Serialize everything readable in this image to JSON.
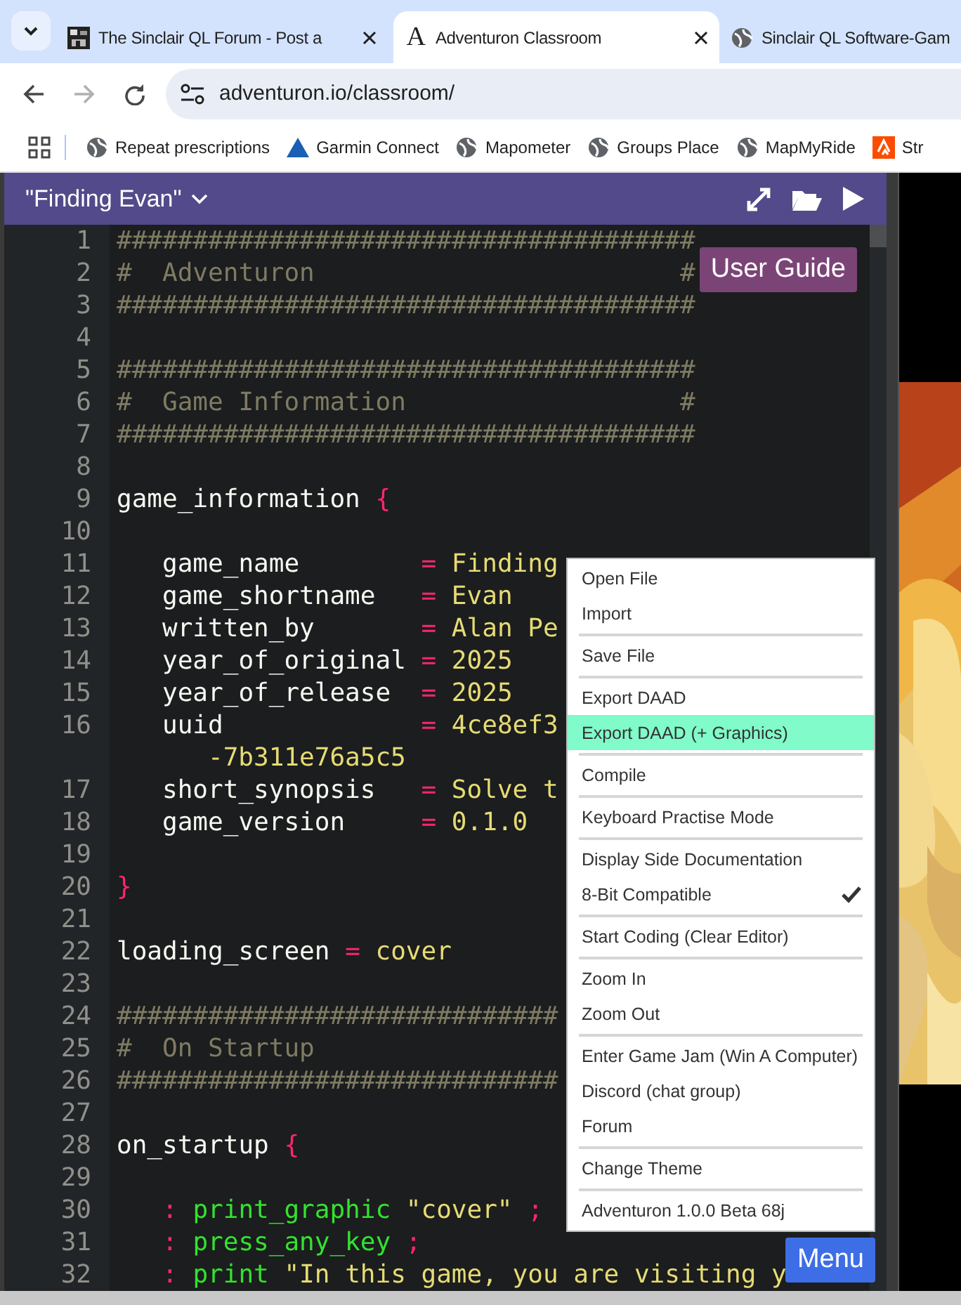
{
  "browser": {
    "tabs": [
      {
        "title": "The Sinclair QL Forum - Post a",
        "selected": false,
        "closable": true
      },
      {
        "title": "Adventuron Classroom",
        "favicon_letter": "A",
        "selected": true,
        "closable": true
      },
      {
        "title": "Sinclair QL Software-Gam",
        "selected": false,
        "closable": false
      }
    ],
    "nav_buttons": [
      {
        "kind": "back",
        "disabled": false
      },
      {
        "kind": "forward",
        "disabled": true
      },
      {
        "kind": "reload",
        "disabled": false
      }
    ],
    "address": "adventuron.io/classroom/",
    "bookmarks": [
      {
        "label": "Repeat prescriptions"
      },
      {
        "label": "Garmin Connect"
      },
      {
        "label": "Mapometer"
      },
      {
        "label": "Groups Place"
      },
      {
        "label": "MapMyRide"
      },
      {
        "label": "Str"
      }
    ]
  },
  "editor": {
    "title": "\"Finding Evan\"",
    "user_guide": "User Guide",
    "menu_button": "Menu",
    "lines": [
      {
        "number": "1",
        "segments": [
          {
            "kind": "comment",
            "text": "######################################"
          }
        ]
      },
      {
        "number": "2",
        "segments": [
          {
            "kind": "comment",
            "text": "#  Adventuron                        #"
          }
        ]
      },
      {
        "number": "3",
        "segments": [
          {
            "kind": "comment",
            "text": "######################################"
          }
        ]
      },
      {
        "number": "4"
      },
      {
        "number": "5",
        "segments": [
          {
            "kind": "comment",
            "text": "######################################"
          }
        ]
      },
      {
        "number": "6",
        "segments": [
          {
            "kind": "comment",
            "text": "#  Game Information                  #"
          }
        ]
      },
      {
        "number": "7",
        "segments": [
          {
            "kind": "comment",
            "text": "######################################"
          }
        ]
      },
      {
        "number": "8"
      },
      {
        "number": "9",
        "segments": [
          {
            "kind": "key",
            "text": "game_information "
          },
          {
            "kind": "brace",
            "text": "{"
          }
        ]
      },
      {
        "number": "10"
      },
      {
        "number": "11",
        "segments": [
          {
            "kind": "key",
            "text": "   game_name        "
          },
          {
            "kind": "op",
            "text": "="
          },
          {
            "kind": "value",
            "text": " Finding"
          }
        ]
      },
      {
        "number": "12",
        "segments": [
          {
            "kind": "key",
            "text": "   game_shortname   "
          },
          {
            "kind": "op",
            "text": "="
          },
          {
            "kind": "value",
            "text": " Evan"
          }
        ]
      },
      {
        "number": "13",
        "segments": [
          {
            "kind": "key",
            "text": "   written_by       "
          },
          {
            "kind": "op",
            "text": "="
          },
          {
            "kind": "value",
            "text": " Alan Pe"
          }
        ]
      },
      {
        "number": "14",
        "segments": [
          {
            "kind": "key",
            "text": "   year_of_original "
          },
          {
            "kind": "op",
            "text": "="
          },
          {
            "kind": "value",
            "text": " 2025"
          }
        ]
      },
      {
        "number": "15",
        "segments": [
          {
            "kind": "key",
            "text": "   year_of_release  "
          },
          {
            "kind": "op",
            "text": "="
          },
          {
            "kind": "value",
            "text": " 2025"
          }
        ]
      },
      {
        "number": "16",
        "segments": [
          {
            "kind": "key",
            "text": "   uuid             "
          },
          {
            "kind": "op",
            "text": "="
          },
          {
            "kind": "value",
            "text": " 4ce8ef3"
          }
        ],
        "wrapped": "-7b311e76a5c5"
      },
      {
        "number": "17",
        "segments": [
          {
            "kind": "key",
            "text": "   short_synopsis   "
          },
          {
            "kind": "op",
            "text": "="
          },
          {
            "kind": "value",
            "text": " Solve t"
          }
        ]
      },
      {
        "number": "18",
        "segments": [
          {
            "kind": "key",
            "text": "   game_version     "
          },
          {
            "kind": "op",
            "text": "="
          },
          {
            "kind": "value",
            "text": " 0.1.0"
          }
        ]
      },
      {
        "number": "19"
      },
      {
        "number": "20",
        "segments": [
          {
            "kind": "brace",
            "text": "}"
          }
        ]
      },
      {
        "number": "21"
      },
      {
        "number": "22",
        "segments": [
          {
            "kind": "key",
            "text": "loading_screen "
          },
          {
            "kind": "op",
            "text": "="
          },
          {
            "kind": "value",
            "text": " cover"
          }
        ]
      },
      {
        "number": "23"
      },
      {
        "number": "24",
        "segments": [
          {
            "kind": "comment",
            "text": "#############################"
          }
        ]
      },
      {
        "number": "25",
        "segments": [
          {
            "kind": "comment",
            "text": "#  On Startup"
          }
        ]
      },
      {
        "number": "26",
        "segments": [
          {
            "kind": "comment",
            "text": "#############################"
          }
        ]
      },
      {
        "number": "27"
      },
      {
        "number": "28",
        "segments": [
          {
            "kind": "key",
            "text": "on_startup "
          },
          {
            "kind": "brace",
            "text": "{"
          }
        ]
      },
      {
        "number": "29"
      },
      {
        "number": "30",
        "segments": [
          {
            "kind": "op",
            "text": "   : "
          },
          {
            "kind": "command",
            "text": "print_graphic "
          },
          {
            "kind": "value",
            "text": "\"cover\" "
          },
          {
            "kind": "op",
            "text": ";"
          }
        ]
      },
      {
        "number": "31",
        "segments": [
          {
            "kind": "op",
            "text": "   : "
          },
          {
            "kind": "command",
            "text": "press_any_key "
          },
          {
            "kind": "op",
            "text": ";"
          }
        ]
      },
      {
        "number": "32",
        "segments": [
          {
            "kind": "op",
            "text": "   : "
          },
          {
            "kind": "command",
            "text": "print "
          },
          {
            "kind": "value",
            "text": "\"In this game, you are visiting y"
          }
        ]
      }
    ]
  },
  "menu": {
    "groups": [
      {
        "items": [
          {
            "label": "Open File",
            "highlighted": false,
            "checked": false
          },
          {
            "label": "Import",
            "highlighted": false,
            "checked": false
          }
        ]
      },
      {
        "items": [
          {
            "label": "Save File",
            "highlighted": false,
            "checked": false
          }
        ]
      },
      {
        "items": [
          {
            "label": "Export DAAD",
            "highlighted": false,
            "checked": false
          },
          {
            "label": "Export DAAD (+ Graphics)",
            "highlighted": true,
            "checked": false
          }
        ]
      },
      {
        "items": [
          {
            "label": "Compile",
            "highlighted": false,
            "checked": false
          }
        ]
      },
      {
        "items": [
          {
            "label": "Keyboard Practise Mode",
            "highlighted": false,
            "checked": false
          }
        ]
      },
      {
        "items": [
          {
            "label": "Display Side Documentation",
            "highlighted": false,
            "checked": false
          },
          {
            "label": "8-Bit Compatible",
            "highlighted": false,
            "checked": true
          }
        ]
      },
      {
        "items": [
          {
            "label": "Start Coding (Clear Editor)",
            "highlighted": false,
            "checked": false
          }
        ]
      },
      {
        "items": [
          {
            "label": "Zoom In",
            "highlighted": false,
            "checked": false
          },
          {
            "label": "Zoom Out",
            "highlighted": false,
            "checked": false
          }
        ]
      },
      {
        "items": [
          {
            "label": "Enter Game Jam (Win A Computer)",
            "highlighted": false,
            "checked": false
          },
          {
            "label": "Discord (chat group)",
            "highlighted": false,
            "checked": false
          },
          {
            "label": "Forum",
            "highlighted": false,
            "checked": false
          }
        ]
      },
      {
        "items": [
          {
            "label": "Change Theme",
            "highlighted": false,
            "checked": false
          }
        ]
      },
      {
        "items": [
          {
            "label": "Adventuron 1.0.0 Beta 68j",
            "highlighted": false,
            "checked": false
          }
        ]
      }
    ]
  }
}
